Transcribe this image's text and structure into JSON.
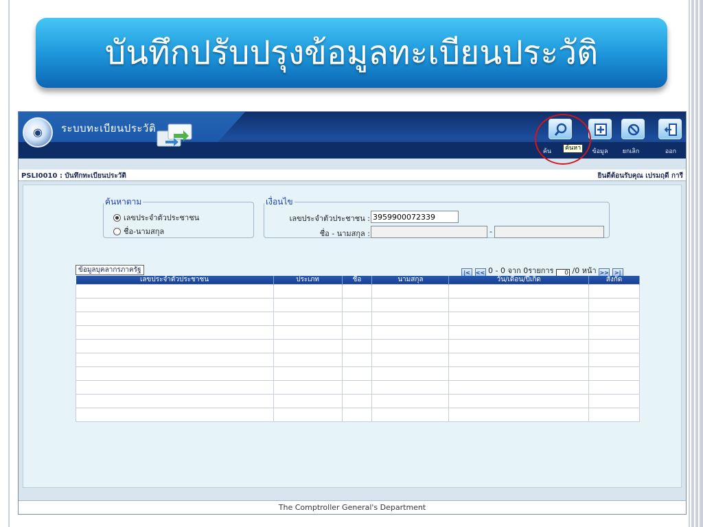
{
  "slide": {
    "title": "บันทึกปรับปรุงข้อมูลทะเบียนประวัติ"
  },
  "app": {
    "system_title": "ระบบทะเบียนประวัติ",
    "toolbar": {
      "search_label": "ค้น",
      "search_tooltip": "ค้นหา",
      "add_label": "ข้อมูล",
      "cancel_label": "ยกเลิก",
      "exit_label": "ออก"
    },
    "subbar": {
      "code": "PSLI0010 : บันทึกทะเบียนประวัติ",
      "welcome": "ยินดีต้อนรับคุณ เปรมฤดี การี"
    },
    "search_by": {
      "legend": "ค้นหาตาม",
      "option_id": "เลขประจำตัวประชาชน",
      "option_name": "ชื่อ-นามสกุล",
      "selected": "id"
    },
    "condition": {
      "legend": "เงื่อนไข",
      "id_label": "เลขประจำตัวประชาชน :",
      "id_value": "3959900072339",
      "name_label": "ชื่อ - นามสกุล :",
      "first_name_value": "",
      "separator": "-",
      "last_name_value": ""
    },
    "grid": {
      "title": "ข้อมูลบุคลากรภาครัฐ",
      "pager": {
        "range_text": "0 - 0 จาก 0รายการ",
        "page_value": "0",
        "page_suffix": "/0 หน้า"
      },
      "columns": [
        "เลขประจำตัวประชาชน",
        "ประเภท",
        "ชื่อ",
        "นามสกุล",
        "วัน/เดือน/ปีเกิด",
        "สังกัด"
      ],
      "empty_rows": 10
    },
    "footer": "The Comptroller General's Department"
  }
}
